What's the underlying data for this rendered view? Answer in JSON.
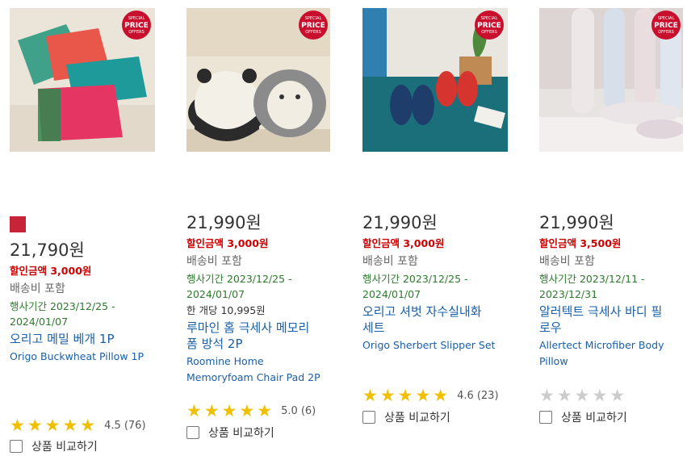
{
  "products": [
    {
      "price": "21,790원",
      "discount": "할인금액 3,000원",
      "shipping": "배송비 포함",
      "period_line1": "행사기간 2023/12/25 -",
      "period_line2": "2024/01/07",
      "title_ko": "오리고 메밀 베개 1P",
      "title_en": "Origo Buckwheat Pillow 1P",
      "rating": "4.5",
      "reviews": "(76)",
      "compare": "상품 비교하기",
      "badge": [
        "SPECIAL",
        "PRICE",
        "OFFERS"
      ],
      "swatch_color": "#c7243a"
    },
    {
      "price": "21,990원",
      "discount": "할인금액 3,000원",
      "shipping": "배송비 포함",
      "period_line1": "행사기간 2023/12/25 -",
      "period_line2": "2024/01/07",
      "unit_price": "한 개당 10,995원",
      "title_ko_line1": "루마인 홈 극세사 메모리",
      "title_ko_line2": "폼 방석 2P",
      "title_en_line1": "Roomine Home",
      "title_en_line2": "Memoryfoam Chair Pad 2P",
      "rating": "5.0",
      "reviews": "(6)",
      "compare": "상품 비교하기",
      "badge": [
        "SPECIAL",
        "PRICE",
        "OFFERS"
      ]
    },
    {
      "price": "21,990원",
      "discount": "할인금액 3,000원",
      "shipping": "배송비 포함",
      "period_line1": "행사기간 2023/12/25 -",
      "period_line2": "2024/01/07",
      "title_ko_line1": "오리고 셔벗 자수실내화",
      "title_ko_line2": "세트",
      "title_en": "Origo Sherbert Slipper Set",
      "rating": "4.6",
      "reviews": "(23)",
      "compare": "상품 비교하기",
      "badge": [
        "SPECIAL",
        "PRICE",
        "OFFERS"
      ]
    },
    {
      "price": "21,990원",
      "discount": "할인금액 3,500원",
      "shipping": "배송비 포함",
      "period_line1": "행사기간 2023/12/11 -",
      "period_line2": "2023/12/31",
      "title_ko_line1": "알러텍트 극세사 바디 필",
      "title_ko_line2": "로우",
      "title_en_line1": "Allertect Microfiber Body",
      "title_en_line2": "Pillow",
      "compare": "상품 비교하기",
      "badge": [
        "SPECIAL",
        "PRICE",
        "OFFERS"
      ]
    }
  ],
  "colors": {
    "discount": "#cc0000",
    "period": "#2d7a2d",
    "link": "#1a5fa8",
    "star": "#f0c000",
    "badge": "#c8102e"
  }
}
